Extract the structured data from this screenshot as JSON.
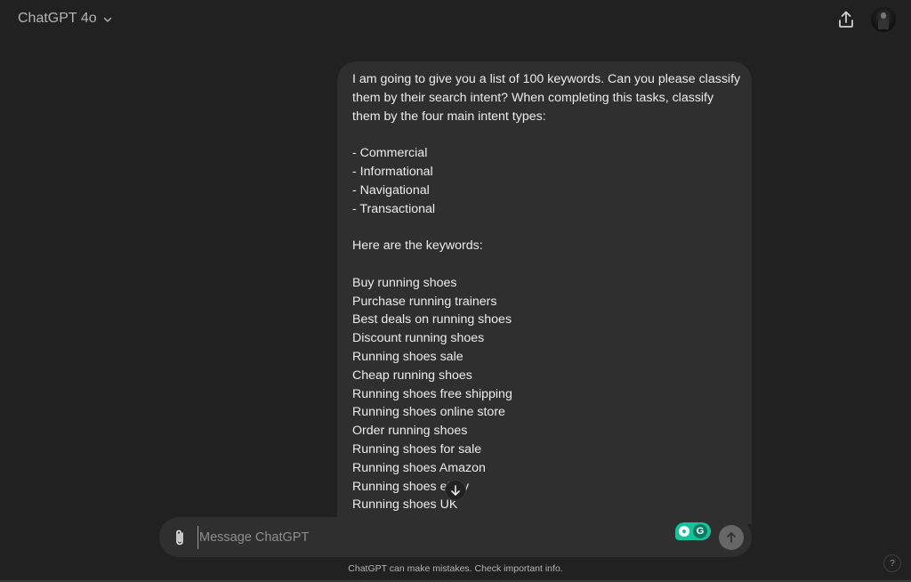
{
  "header": {
    "model_label": "ChatGPT 4o",
    "model_dropdown_icon": "chevron-down-icon",
    "share_icon": "share-upload-icon",
    "avatar_icon": "user-avatar"
  },
  "message": {
    "role": "user",
    "lines": [
      "I am going to give you a list of 100 keywords. Can you please classify",
      "them by their search intent? When completing this tasks, classify",
      "them by the four main intent types:",
      "",
      "- Commercial",
      "- Informational",
      "- Navigational",
      "- Transactional",
      "",
      "Here are the keywords:",
      "",
      "Buy running shoes",
      "Purchase running trainers",
      "Best deals on running shoes",
      "Discount running shoes",
      "Running shoes sale",
      "Cheap running shoes",
      "Running shoes free shipping",
      "Running shoes online store",
      "Order running shoes",
      "Running shoes for sale",
      "Running shoes Amazon",
      "Running shoes eBay",
      "Running shoes UK"
    ]
  },
  "scroll_down_icon": "arrow-down-icon",
  "composer": {
    "placeholder": "Message ChatGPT",
    "value": "",
    "attach_icon": "paperclip-icon",
    "send_icon": "arrow-up-icon",
    "grammarly_g": "G"
  },
  "footer": {
    "disclaimer": "ChatGPT can make mistakes. Check important info.",
    "help_label": "?"
  }
}
